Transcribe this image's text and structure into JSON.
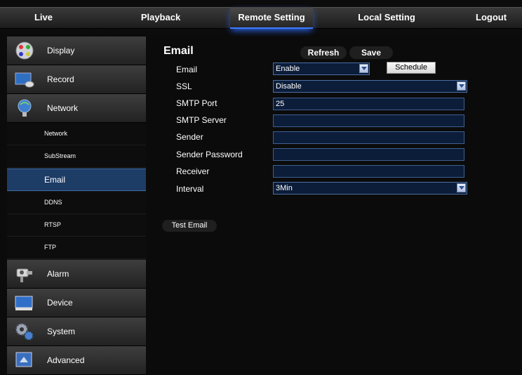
{
  "topnav": {
    "tabs": [
      {
        "label": "Live"
      },
      {
        "label": "Playback"
      },
      {
        "label": "Remote Setting"
      },
      {
        "label": "Local Setting"
      },
      {
        "label": "Logout"
      }
    ],
    "active": "Remote Setting"
  },
  "sidebar": {
    "items": [
      {
        "label": "Display",
        "icon": "display-icon"
      },
      {
        "label": "Record",
        "icon": "record-icon"
      },
      {
        "label": "Network",
        "icon": "network-icon"
      },
      {
        "label": "Alarm",
        "icon": "alarm-icon"
      },
      {
        "label": "Device",
        "icon": "device-icon"
      },
      {
        "label": "System",
        "icon": "system-icon"
      },
      {
        "label": "Advanced",
        "icon": "advanced-icon"
      }
    ],
    "network_sub": [
      {
        "label": "Network"
      },
      {
        "label": "SubStream"
      },
      {
        "label": "Email"
      },
      {
        "label": "DDNS"
      },
      {
        "label": "RTSP"
      },
      {
        "label": "FTP"
      }
    ],
    "active_sub": "Email"
  },
  "main": {
    "title": "Email",
    "refresh_label": "Refresh",
    "save_label": "Save",
    "schedule_label": "Schedule",
    "test_email_label": "Test Email",
    "fields": {
      "email": {
        "label": "Email",
        "value": "Enable"
      },
      "ssl": {
        "label": "SSL",
        "value": "Disable"
      },
      "smtp_port": {
        "label": "SMTP Port",
        "value": "25"
      },
      "smtp_server": {
        "label": "SMTP Server",
        "value": ""
      },
      "sender": {
        "label": "Sender",
        "value": ""
      },
      "sender_password": {
        "label": "Sender Password",
        "value": ""
      },
      "receiver": {
        "label": "Receiver",
        "value": ""
      },
      "interval": {
        "label": "Interval",
        "value": "3Min"
      }
    }
  },
  "colors": {
    "accent": "#3d7cff",
    "active_sub_bg": "#1d3c66",
    "field_bg": "#0c1d3a"
  }
}
